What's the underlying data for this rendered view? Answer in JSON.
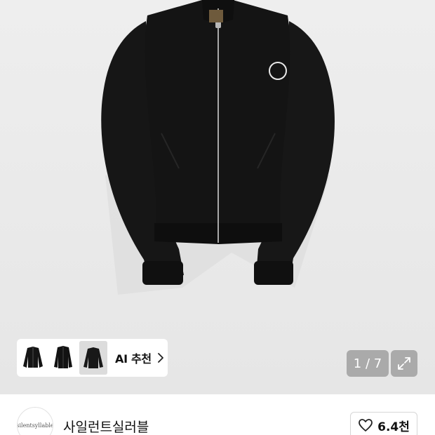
{
  "product_image": {
    "image_name": "black-zip-up-track-jacket",
    "badge_icon": "circle-patch-icon"
  },
  "ai_recommend": {
    "label": "AI 추천",
    "thumbnails": [
      "bomber-jacket-thumb",
      "knit-zip-jacket-thumb",
      "black-jacket-thumb"
    ],
    "chevron_icon": "chevron-right-icon"
  },
  "gallery": {
    "counter": "1 / 7",
    "expand_icon": "expand-icon"
  },
  "store": {
    "logo_text": "silentsyllable",
    "name": "사일런트실러블"
  },
  "like": {
    "icon": "heart-icon",
    "count": "6.4천"
  },
  "colors": {
    "hero_bg": "#ececec",
    "overlay_btn": "#969696",
    "jacket": "#161616"
  }
}
